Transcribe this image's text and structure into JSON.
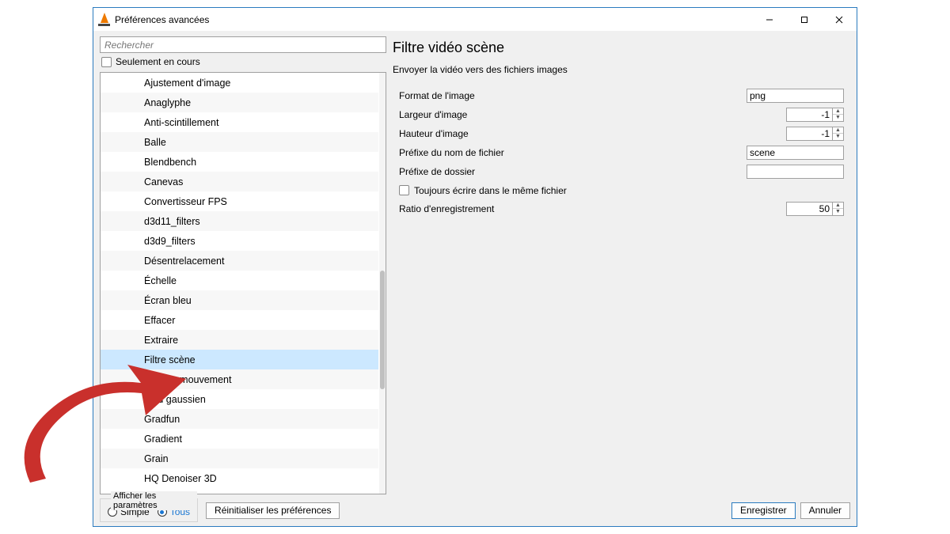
{
  "window": {
    "title": "Préférences avancées"
  },
  "search": {
    "placeholder": "Rechercher"
  },
  "only_current": {
    "label": "Seulement en cours"
  },
  "tree": {
    "items": [
      {
        "label": "Ajustement d'image"
      },
      {
        "label": "Anaglyphe"
      },
      {
        "label": "Anti-scintillement"
      },
      {
        "label": "Balle"
      },
      {
        "label": "Blendbench"
      },
      {
        "label": "Canevas"
      },
      {
        "label": "Convertisseur FPS"
      },
      {
        "label": "d3d11_filters"
      },
      {
        "label": "d3d9_filters"
      },
      {
        "label": "Désentrelacement"
      },
      {
        "label": "Échelle"
      },
      {
        "label": "Écran bleu"
      },
      {
        "label": "Effacer"
      },
      {
        "label": "Extraire"
      },
      {
        "label": "Filtre scène",
        "selected": true
      },
      {
        "label": "Flou de mouvement"
      },
      {
        "label": "Flou gaussien"
      },
      {
        "label": "Gradfun"
      },
      {
        "label": "Gradient"
      },
      {
        "label": "Grain"
      },
      {
        "label": "HQ Denoiser 3D"
      }
    ]
  },
  "panel": {
    "title": "Filtre vidéo scène",
    "desc": "Envoyer la vidéo vers des fichiers images",
    "rows": {
      "format": {
        "label": "Format de l'image",
        "value": "png"
      },
      "width": {
        "label": "Largeur d'image",
        "value": "-1"
      },
      "height": {
        "label": "Hauteur d'image",
        "value": "-1"
      },
      "fileprefix": {
        "label": "Préfixe du nom de fichier",
        "value": "scene"
      },
      "dirprefix": {
        "label": "Préfixe de dossier",
        "value": ""
      },
      "always": {
        "label": "Toujours écrire dans le même fichier"
      },
      "ratio": {
        "label": "Ratio d'enregistrement",
        "value": "50"
      }
    }
  },
  "footer": {
    "show_settings": "Afficher les paramètres",
    "simple": "Simple",
    "all": "Tous",
    "reset": "Réinitialiser les préférences",
    "save": "Enregistrer",
    "cancel": "Annuler"
  }
}
